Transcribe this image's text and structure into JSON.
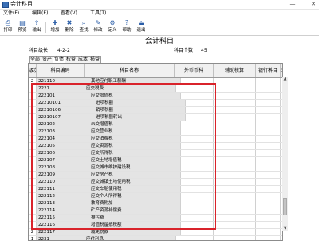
{
  "window": {
    "title": "会计科目",
    "controls": [
      "—",
      "□",
      "✕"
    ]
  },
  "menu": [
    "文件(F)",
    "编辑(E)",
    "查看(V)",
    "工具(T)"
  ],
  "toolbar": [
    {
      "icon": "print-icon",
      "glyph": "⎙",
      "label": "打印"
    },
    {
      "icon": "preview-icon",
      "glyph": "▤",
      "label": "预览"
    },
    {
      "icon": "export-icon",
      "glyph": "⇪",
      "label": "输出"
    },
    {
      "icon": "add-icon",
      "glyph": "✚",
      "label": "增加"
    },
    {
      "icon": "delete-icon",
      "glyph": "✖",
      "label": "删除"
    },
    {
      "icon": "find-icon",
      "glyph": "⌕",
      "label": "查找"
    },
    {
      "icon": "edit-icon",
      "glyph": "✎",
      "label": "修改"
    },
    {
      "icon": "define-icon",
      "glyph": "⚙",
      "label": "定义"
    },
    {
      "icon": "help-icon",
      "glyph": "?",
      "label": "帮助"
    },
    {
      "icon": "exit-icon",
      "glyph": "⏏",
      "label": "退出"
    }
  ],
  "heading": "会计科目",
  "info": {
    "level_label": "科目级长",
    "level_value": "4-2-2",
    "count_label": "科目个数",
    "count_value": "45"
  },
  "tabs": [
    "全部",
    "资产",
    "负债",
    "权益",
    "成本",
    "损益"
  ],
  "active_tab": 2,
  "columns": [
    "级次",
    "科目编码",
    "科目名称",
    "外币币种",
    "辅助核算",
    "银行科目",
    "现金"
  ],
  "rows": [
    {
      "level": "2",
      "code": "221110",
      "name": "其他应付职工薪酬"
    },
    {
      "level": "1",
      "code": "2221",
      "name": "应交税费"
    },
    {
      "level": "2",
      "code": "222101",
      "name": "应交增值税"
    },
    {
      "level": "3",
      "code": "22210101",
      "name": "进项税额"
    },
    {
      "level": "3",
      "code": "22210106",
      "name": "销项税额"
    },
    {
      "level": "3",
      "code": "22210107",
      "name": "进项税额转出"
    },
    {
      "level": "2",
      "code": "222102",
      "name": "未交增值税"
    },
    {
      "level": "2",
      "code": "222103",
      "name": "应交营业税"
    },
    {
      "level": "2",
      "code": "222104",
      "name": "应交消费税"
    },
    {
      "level": "2",
      "code": "222105",
      "name": "应交资源税"
    },
    {
      "level": "2",
      "code": "222106",
      "name": "应交所得税"
    },
    {
      "level": "2",
      "code": "222107",
      "name": "应交土地增值税"
    },
    {
      "level": "2",
      "code": "222108",
      "name": "应交城市维护建设税"
    },
    {
      "level": "2",
      "code": "222109",
      "name": "应交房产税"
    },
    {
      "level": "2",
      "code": "222110",
      "name": "应交城镇土地使用税"
    },
    {
      "level": "2",
      "code": "222111",
      "name": "应交车船使用税"
    },
    {
      "level": "2",
      "code": "222112",
      "name": "应交个人所得税"
    },
    {
      "level": "2",
      "code": "222113",
      "name": "教育费附加"
    },
    {
      "level": "2",
      "code": "222114",
      "name": "矿产资源补偿费"
    },
    {
      "level": "2",
      "code": "222115",
      "name": "排污费"
    },
    {
      "level": "2",
      "code": "222116",
      "name": "增值税留抵税额"
    },
    {
      "level": "2",
      "code": "222117",
      "name": "减免税款"
    },
    {
      "level": "1",
      "code": "2231",
      "name": "应付利息"
    },
    {
      "level": "1",
      "code": "2232",
      "name": "应付股利"
    }
  ],
  "colors": {
    "highlight_border": "#d9232b",
    "selected_bg": "#e4e4e4",
    "icon_blue": "#2b5ea8"
  }
}
